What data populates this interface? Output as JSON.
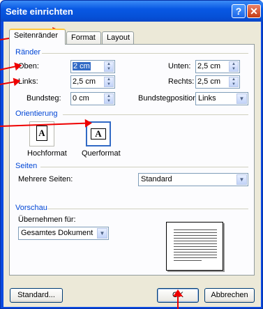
{
  "window": {
    "title": "Seite einrichten",
    "help": "?",
    "close": "✕"
  },
  "tabs": [
    {
      "label": "Seitenränder",
      "active": true
    },
    {
      "label": "Format"
    },
    {
      "label": "Layout"
    }
  ],
  "margins": {
    "group": "Ränder",
    "top_label": "Oben:",
    "top_value": "2 cm",
    "bottom_label": "Unten:",
    "bottom_value": "2,5 cm",
    "left_label": "Links:",
    "left_value": "2,5 cm",
    "right_label": "Rechts:",
    "right_value": "2,5 cm",
    "gutter_label": "Bundsteg:",
    "gutter_value": "0 cm",
    "gutter_pos_label": "Bundstegposition:",
    "gutter_pos_value": "Links"
  },
  "orientation": {
    "group": "Orientierung",
    "portrait_label": "Hochformat",
    "landscape_label": "Querformat",
    "glyph": "A",
    "selected": "Querformat"
  },
  "pages": {
    "group": "Seiten",
    "multiple_label": "Mehrere Seiten:",
    "multiple_value": "Standard"
  },
  "preview": {
    "group": "Vorschau",
    "apply_label": "Übernehmen für:",
    "apply_value": "Gesamtes Dokument"
  },
  "buttons": {
    "default": "Standard...",
    "ok": "OK",
    "cancel": "Abbrechen"
  },
  "colors": {
    "title_bar": "#0858e4",
    "group_label": "#0046d5",
    "annotation_arrow": "#e00000",
    "selection": "#316ac5"
  },
  "icons": [
    "spin-arrows-icon",
    "dropdown-arrow-icon",
    "portrait-page-icon",
    "landscape-page-icon",
    "help-icon",
    "close-icon",
    "annotation-arrow"
  ]
}
